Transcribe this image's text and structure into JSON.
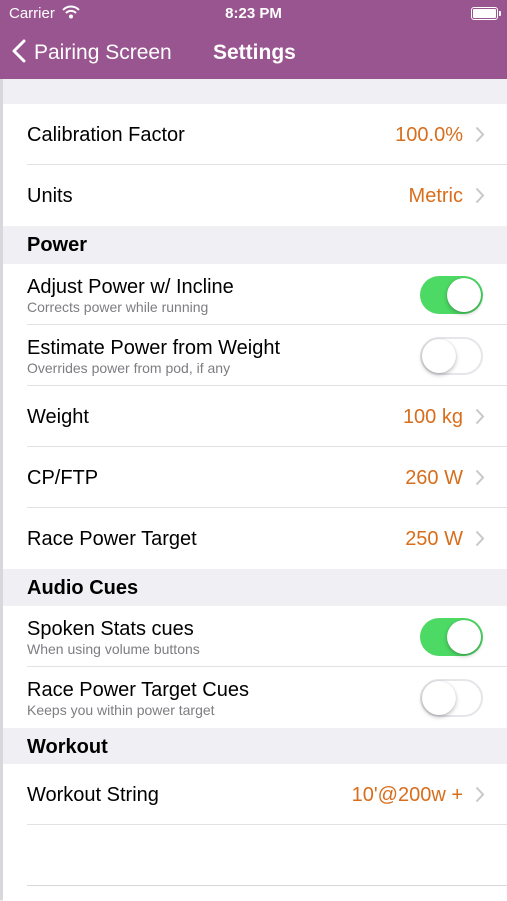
{
  "status_bar": {
    "carrier": "Carrier",
    "time": "8:23 PM"
  },
  "nav": {
    "back_label": "Pairing Screen",
    "title": "Settings"
  },
  "colors": {
    "nav_background": "#98558f",
    "value_text": "#d86e1c",
    "toggle_on": "#4cd964"
  },
  "general": {
    "calibration": {
      "label": "Calibration Factor",
      "value": "100.0%"
    },
    "units": {
      "label": "Units",
      "value": "Metric"
    }
  },
  "power": {
    "header": "Power",
    "adjust_incline": {
      "label": "Adjust Power w/ Incline",
      "sublabel": "Corrects power while running",
      "enabled": true
    },
    "estimate_weight": {
      "label": "Estimate Power from Weight",
      "sublabel": "Overrides power from pod, if any",
      "enabled": false
    },
    "weight": {
      "label": "Weight",
      "value": "100 kg"
    },
    "cp_ftp": {
      "label": "CP/FTP",
      "value": "260 W"
    },
    "race_target": {
      "label": "Race Power Target",
      "value": "250 W"
    }
  },
  "audio": {
    "header": "Audio Cues",
    "spoken_stats": {
      "label": "Spoken Stats cues",
      "sublabel": "When using volume buttons",
      "enabled": true
    },
    "race_target_cues": {
      "label": "Race Power Target Cues",
      "sublabel": "Keeps you within power target",
      "enabled": false
    }
  },
  "workout": {
    "header": "Workout",
    "workout_string": {
      "label": "Workout String",
      "value": "10'@200w +"
    }
  }
}
